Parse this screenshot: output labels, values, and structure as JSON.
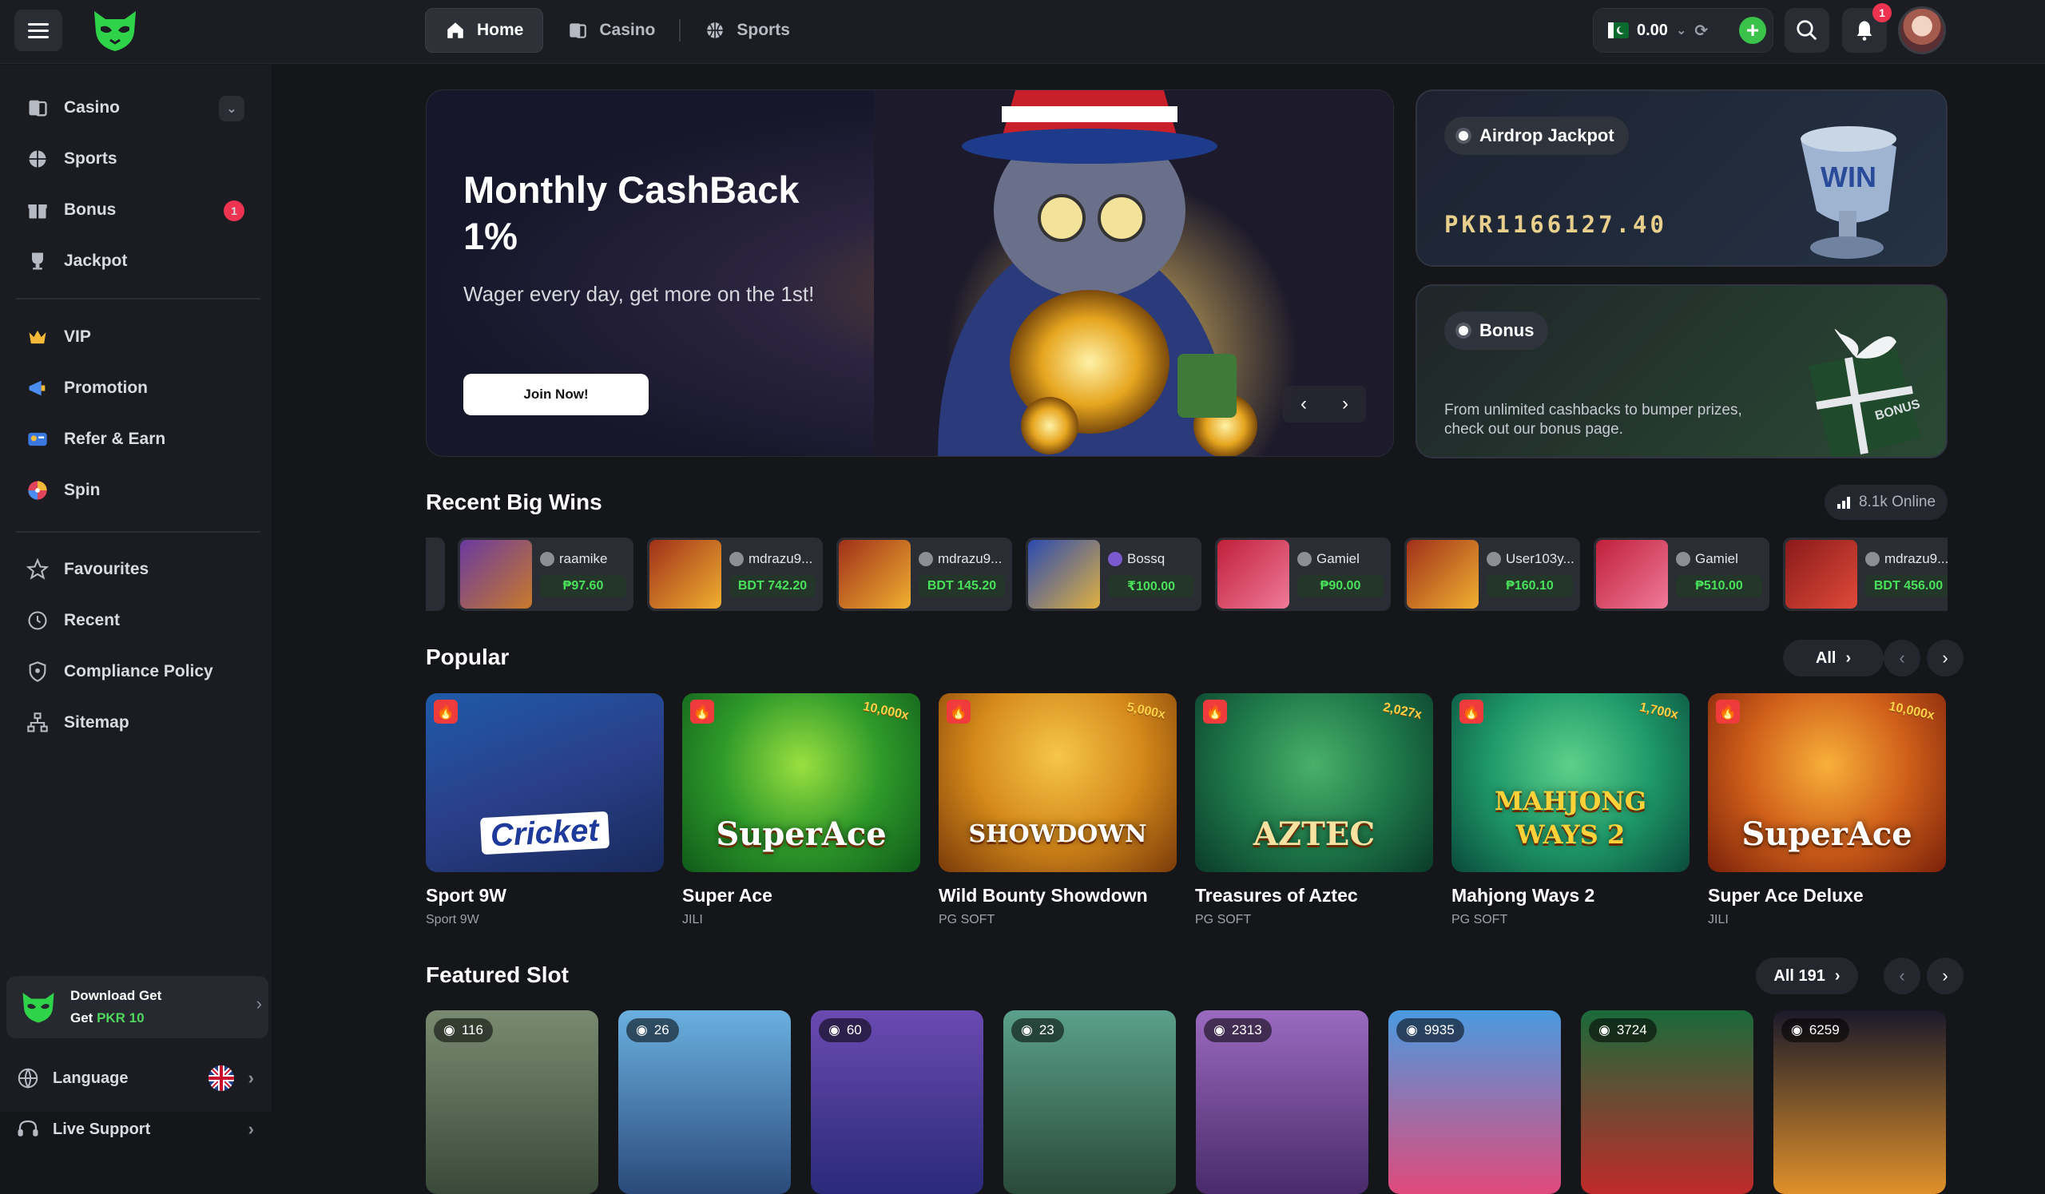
{
  "nav": {
    "tabs": [
      {
        "label": "Home",
        "icon": "home-icon"
      },
      {
        "label": "Casino",
        "icon": "casino-icon"
      },
      {
        "label": "Sports",
        "icon": "sports-icon"
      }
    ]
  },
  "wallet": {
    "balance": "0.00"
  },
  "notifications": {
    "count": "1"
  },
  "sidebar": {
    "items": [
      {
        "label": "Casino"
      },
      {
        "label": "Sports"
      },
      {
        "label": "Bonus",
        "badge": "1"
      },
      {
        "label": "Jackpot"
      },
      {
        "label": "VIP"
      },
      {
        "label": "Promotion"
      },
      {
        "label": "Refer & Earn"
      },
      {
        "label": "Spin"
      },
      {
        "label": "Favourites"
      },
      {
        "label": "Recent"
      },
      {
        "label": "Compliance Policy"
      },
      {
        "label": "Sitemap"
      }
    ],
    "download": {
      "line1": "Download Get",
      "line2_prefix": "Get ",
      "line2_amount": "PKR 10"
    },
    "language": "Language",
    "live_support": "Live Support"
  },
  "hero": {
    "title": "Monthly CashBack 1%",
    "subtitle": "Wager every day, get more on the 1st!",
    "button": "Join Now!"
  },
  "airdrop": {
    "label": "Airdrop Jackpot",
    "amount": "PKR1166127.40"
  },
  "bonus_card": {
    "label": "Bonus",
    "description": "From unlimited cashbacks to bumper prizes, check out our bonus page."
  },
  "big_wins": {
    "title": "Recent Big Wins",
    "online": "8.1k Online",
    "items": [
      {
        "user": "raamike",
        "amount": "₱97.60"
      },
      {
        "user": "mdrazu9...",
        "amount": "BDT 742.20"
      },
      {
        "user": "mdrazu9...",
        "amount": "BDT 145.20"
      },
      {
        "user": "Bossq",
        "amount": "₹100.00"
      },
      {
        "user": "Gamiel",
        "amount": "₱90.00"
      },
      {
        "user": "User103y...",
        "amount": "₱160.10"
      },
      {
        "user": "Gamiel",
        "amount": "₱510.00"
      },
      {
        "user": "mdrazu9...",
        "amount": "BDT 456.00"
      }
    ]
  },
  "popular": {
    "title": "Popular",
    "all_label": "All",
    "games": [
      {
        "name": "Sport 9W",
        "provider": "Sport 9W",
        "logo": "Cricket",
        "multiplier": ""
      },
      {
        "name": "Super Ace",
        "provider": "JILI",
        "logo": "SuperAce",
        "multiplier": "10,000x"
      },
      {
        "name": "Wild Bounty Showdown",
        "provider": "PG SOFT",
        "logo": "SHOWDOWN",
        "multiplier": "5,000x"
      },
      {
        "name": "Treasures of Aztec",
        "provider": "PG SOFT",
        "logo": "AZTEC",
        "multiplier": "2,027x"
      },
      {
        "name": "Mahjong Ways 2",
        "provider": "PG SOFT",
        "logo": "MAHJONG WAYS 2",
        "multiplier": "1,700x"
      },
      {
        "name": "Super Ace Deluxe",
        "provider": "JILI",
        "logo": "SuperAce",
        "multiplier": "10,000x"
      }
    ]
  },
  "featured": {
    "title": "Featured Slot",
    "all_label": "All 191",
    "slots": [
      {
        "views": "116"
      },
      {
        "views": "26"
      },
      {
        "views": "60"
      },
      {
        "views": "23"
      },
      {
        "views": "2313"
      },
      {
        "views": "9935"
      },
      {
        "views": "3724"
      },
      {
        "views": "6259"
      }
    ]
  },
  "colors": {
    "accent_green": "#3bc24a",
    "badge_red": "#ee3350",
    "bg": "#14161a",
    "gold": "#e8cf8c"
  }
}
